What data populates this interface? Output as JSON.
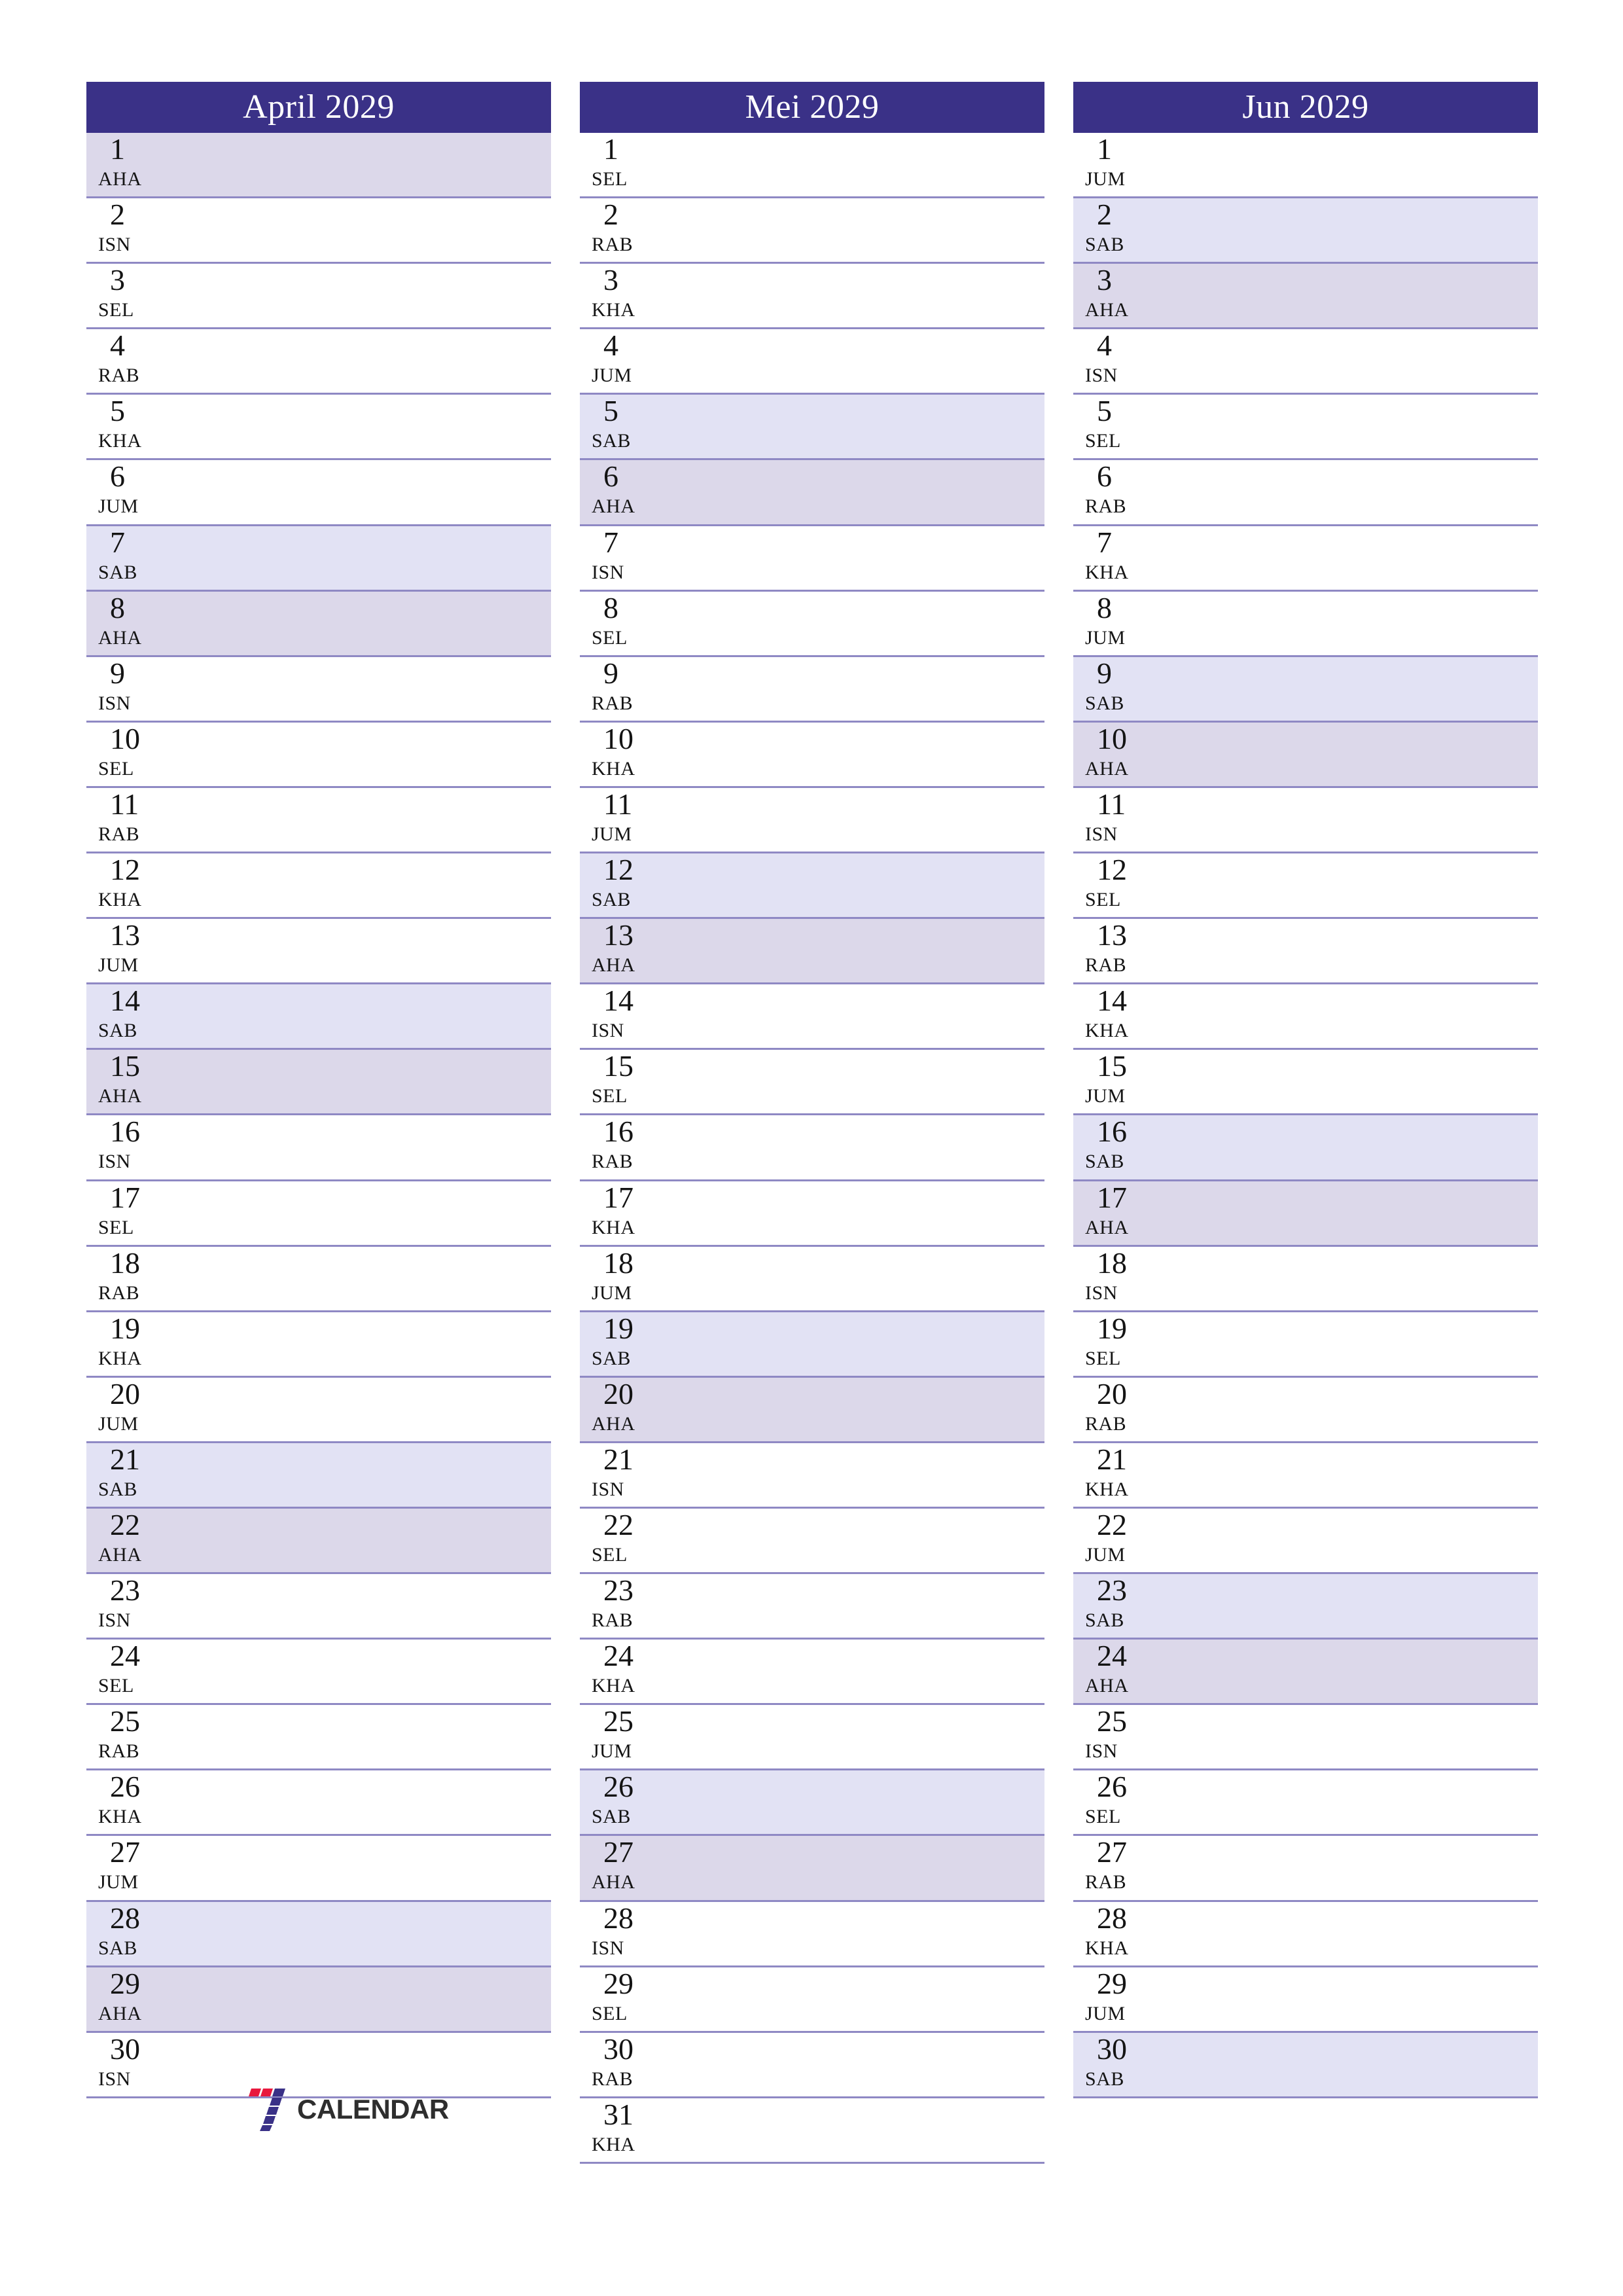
{
  "colors": {
    "header_bg": "#3a3187",
    "header_text": "#ffffff",
    "saturday_bg": "#e2e2f4",
    "sunday_bg": "#dcd8ea",
    "row_border": "#8f89c4",
    "page_bg": "#ffffff",
    "logo_red": "#e8173d",
    "logo_purple": "#3a3187",
    "logo_text": "#2e2e2e"
  },
  "branding": {
    "logo_text": "CALENDAR",
    "logo_mark": "seven-stripes-mark"
  },
  "months": [
    {
      "title": "April 2029",
      "days": [
        {
          "num": "1",
          "dow": "AHA",
          "type": "sun"
        },
        {
          "num": "2",
          "dow": "ISN",
          "type": "weekday"
        },
        {
          "num": "3",
          "dow": "SEL",
          "type": "weekday"
        },
        {
          "num": "4",
          "dow": "RAB",
          "type": "weekday"
        },
        {
          "num": "5",
          "dow": "KHA",
          "type": "weekday"
        },
        {
          "num": "6",
          "dow": "JUM",
          "type": "weekday"
        },
        {
          "num": "7",
          "dow": "SAB",
          "type": "sat"
        },
        {
          "num": "8",
          "dow": "AHA",
          "type": "sun"
        },
        {
          "num": "9",
          "dow": "ISN",
          "type": "weekday"
        },
        {
          "num": "10",
          "dow": "SEL",
          "type": "weekday"
        },
        {
          "num": "11",
          "dow": "RAB",
          "type": "weekday"
        },
        {
          "num": "12",
          "dow": "KHA",
          "type": "weekday"
        },
        {
          "num": "13",
          "dow": "JUM",
          "type": "weekday"
        },
        {
          "num": "14",
          "dow": "SAB",
          "type": "sat"
        },
        {
          "num": "15",
          "dow": "AHA",
          "type": "sun"
        },
        {
          "num": "16",
          "dow": "ISN",
          "type": "weekday"
        },
        {
          "num": "17",
          "dow": "SEL",
          "type": "weekday"
        },
        {
          "num": "18",
          "dow": "RAB",
          "type": "weekday"
        },
        {
          "num": "19",
          "dow": "KHA",
          "type": "weekday"
        },
        {
          "num": "20",
          "dow": "JUM",
          "type": "weekday"
        },
        {
          "num": "21",
          "dow": "SAB",
          "type": "sat"
        },
        {
          "num": "22",
          "dow": "AHA",
          "type": "sun"
        },
        {
          "num": "23",
          "dow": "ISN",
          "type": "weekday"
        },
        {
          "num": "24",
          "dow": "SEL",
          "type": "weekday"
        },
        {
          "num": "25",
          "dow": "RAB",
          "type": "weekday"
        },
        {
          "num": "26",
          "dow": "KHA",
          "type": "weekday"
        },
        {
          "num": "27",
          "dow": "JUM",
          "type": "weekday"
        },
        {
          "num": "28",
          "dow": "SAB",
          "type": "sat"
        },
        {
          "num": "29",
          "dow": "AHA",
          "type": "sun"
        },
        {
          "num": "30",
          "dow": "ISN",
          "type": "weekday"
        }
      ]
    },
    {
      "title": "Mei 2029",
      "days": [
        {
          "num": "1",
          "dow": "SEL",
          "type": "weekday"
        },
        {
          "num": "2",
          "dow": "RAB",
          "type": "weekday"
        },
        {
          "num": "3",
          "dow": "KHA",
          "type": "weekday"
        },
        {
          "num": "4",
          "dow": "JUM",
          "type": "weekday"
        },
        {
          "num": "5",
          "dow": "SAB",
          "type": "sat"
        },
        {
          "num": "6",
          "dow": "AHA",
          "type": "sun"
        },
        {
          "num": "7",
          "dow": "ISN",
          "type": "weekday"
        },
        {
          "num": "8",
          "dow": "SEL",
          "type": "weekday"
        },
        {
          "num": "9",
          "dow": "RAB",
          "type": "weekday"
        },
        {
          "num": "10",
          "dow": "KHA",
          "type": "weekday"
        },
        {
          "num": "11",
          "dow": "JUM",
          "type": "weekday"
        },
        {
          "num": "12",
          "dow": "SAB",
          "type": "sat"
        },
        {
          "num": "13",
          "dow": "AHA",
          "type": "sun"
        },
        {
          "num": "14",
          "dow": "ISN",
          "type": "weekday"
        },
        {
          "num": "15",
          "dow": "SEL",
          "type": "weekday"
        },
        {
          "num": "16",
          "dow": "RAB",
          "type": "weekday"
        },
        {
          "num": "17",
          "dow": "KHA",
          "type": "weekday"
        },
        {
          "num": "18",
          "dow": "JUM",
          "type": "weekday"
        },
        {
          "num": "19",
          "dow": "SAB",
          "type": "sat"
        },
        {
          "num": "20",
          "dow": "AHA",
          "type": "sun"
        },
        {
          "num": "21",
          "dow": "ISN",
          "type": "weekday"
        },
        {
          "num": "22",
          "dow": "SEL",
          "type": "weekday"
        },
        {
          "num": "23",
          "dow": "RAB",
          "type": "weekday"
        },
        {
          "num": "24",
          "dow": "KHA",
          "type": "weekday"
        },
        {
          "num": "25",
          "dow": "JUM",
          "type": "weekday"
        },
        {
          "num": "26",
          "dow": "SAB",
          "type": "sat"
        },
        {
          "num": "27",
          "dow": "AHA",
          "type": "sun"
        },
        {
          "num": "28",
          "dow": "ISN",
          "type": "weekday"
        },
        {
          "num": "29",
          "dow": "SEL",
          "type": "weekday"
        },
        {
          "num": "30",
          "dow": "RAB",
          "type": "weekday"
        },
        {
          "num": "31",
          "dow": "KHA",
          "type": "weekday"
        }
      ]
    },
    {
      "title": "Jun 2029",
      "days": [
        {
          "num": "1",
          "dow": "JUM",
          "type": "weekday"
        },
        {
          "num": "2",
          "dow": "SAB",
          "type": "sat"
        },
        {
          "num": "3",
          "dow": "AHA",
          "type": "sun"
        },
        {
          "num": "4",
          "dow": "ISN",
          "type": "weekday"
        },
        {
          "num": "5",
          "dow": "SEL",
          "type": "weekday"
        },
        {
          "num": "6",
          "dow": "RAB",
          "type": "weekday"
        },
        {
          "num": "7",
          "dow": "KHA",
          "type": "weekday"
        },
        {
          "num": "8",
          "dow": "JUM",
          "type": "weekday"
        },
        {
          "num": "9",
          "dow": "SAB",
          "type": "sat"
        },
        {
          "num": "10",
          "dow": "AHA",
          "type": "sun"
        },
        {
          "num": "11",
          "dow": "ISN",
          "type": "weekday"
        },
        {
          "num": "12",
          "dow": "SEL",
          "type": "weekday"
        },
        {
          "num": "13",
          "dow": "RAB",
          "type": "weekday"
        },
        {
          "num": "14",
          "dow": "KHA",
          "type": "weekday"
        },
        {
          "num": "15",
          "dow": "JUM",
          "type": "weekday"
        },
        {
          "num": "16",
          "dow": "SAB",
          "type": "sat"
        },
        {
          "num": "17",
          "dow": "AHA",
          "type": "sun"
        },
        {
          "num": "18",
          "dow": "ISN",
          "type": "weekday"
        },
        {
          "num": "19",
          "dow": "SEL",
          "type": "weekday"
        },
        {
          "num": "20",
          "dow": "RAB",
          "type": "weekday"
        },
        {
          "num": "21",
          "dow": "KHA",
          "type": "weekday"
        },
        {
          "num": "22",
          "dow": "JUM",
          "type": "weekday"
        },
        {
          "num": "23",
          "dow": "SAB",
          "type": "sat"
        },
        {
          "num": "24",
          "dow": "AHA",
          "type": "sun"
        },
        {
          "num": "25",
          "dow": "ISN",
          "type": "weekday"
        },
        {
          "num": "26",
          "dow": "SEL",
          "type": "weekday"
        },
        {
          "num": "27",
          "dow": "RAB",
          "type": "weekday"
        },
        {
          "num": "28",
          "dow": "KHA",
          "type": "weekday"
        },
        {
          "num": "29",
          "dow": "JUM",
          "type": "weekday"
        },
        {
          "num": "30",
          "dow": "SAB",
          "type": "sat"
        }
      ]
    }
  ]
}
